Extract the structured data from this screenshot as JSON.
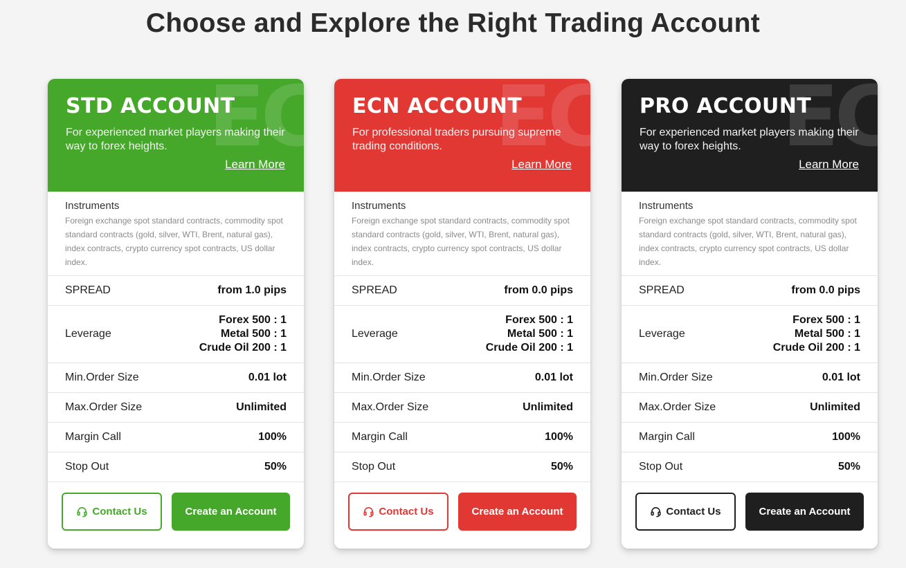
{
  "page": {
    "title": "Choose and Explore the Right Trading Account"
  },
  "watermark": "EC",
  "labels": {
    "instruments": "Instruments",
    "spread": "SPREAD",
    "leverage": "Leverage",
    "min_order": "Min.Order Size",
    "max_order": "Max.Order Size",
    "margin_call": "Margin Call",
    "stop_out": "Stop Out"
  },
  "icons": {
    "contact": "headset-icon"
  },
  "accounts": [
    {
      "name": "STD ACCOUNT",
      "color": "#45a82b",
      "description": "For experienced market players making their way to forex heights.",
      "learn_more": "Learn More",
      "instruments": "Foreign exchange spot standard contracts, commodity spot standard contracts (gold, silver, WTI, Brent, natural gas), index contracts, crypto currency spot contracts, US dollar index.",
      "spread": "from 1.0 pips",
      "leverage": [
        "Forex 500 : 1",
        "Metal 500 : 1",
        "Crude Oil 200 : 1"
      ],
      "min_order": "0.01 lot",
      "max_order": "Unlimited",
      "margin_call": "100%",
      "stop_out": "50%",
      "contact_label": "Contact Us",
      "create_label": "Create an Account"
    },
    {
      "name": "ECN ACCOUNT",
      "color": "#e23834",
      "description": "For professional traders pursuing supreme trading conditions.",
      "learn_more": "Learn More",
      "instruments": "Foreign exchange spot standard contracts, commodity spot standard contracts (gold, silver, WTI, Brent, natural gas), index contracts, crypto currency spot contracts, US dollar index.",
      "spread": "from 0.0 pips",
      "leverage": [
        "Forex 500 : 1",
        "Metal 500 : 1",
        "Crude Oil 200 : 1"
      ],
      "min_order": "0.01 lot",
      "max_order": "Unlimited",
      "margin_call": "100%",
      "stop_out": "50%",
      "contact_label": "Contact Us",
      "create_label": "Create an Account"
    },
    {
      "name": "PRO ACCOUNT",
      "color": "#1f1f1f",
      "description": "For experienced market players making their way to forex heights.",
      "learn_more": "Learn More",
      "instruments": "Foreign exchange spot standard contracts, commodity spot standard contracts (gold, silver, WTI, Brent, natural gas), index contracts, crypto currency spot contracts, US dollar index.",
      "spread": "from 0.0 pips",
      "leverage": [
        "Forex 500 : 1",
        "Metal 500 : 1",
        "Crude Oil 200 : 1"
      ],
      "min_order": "0.01 lot",
      "max_order": "Unlimited",
      "margin_call": "100%",
      "stop_out": "50%",
      "contact_label": "Contact Us",
      "create_label": "Create an Account"
    }
  ]
}
